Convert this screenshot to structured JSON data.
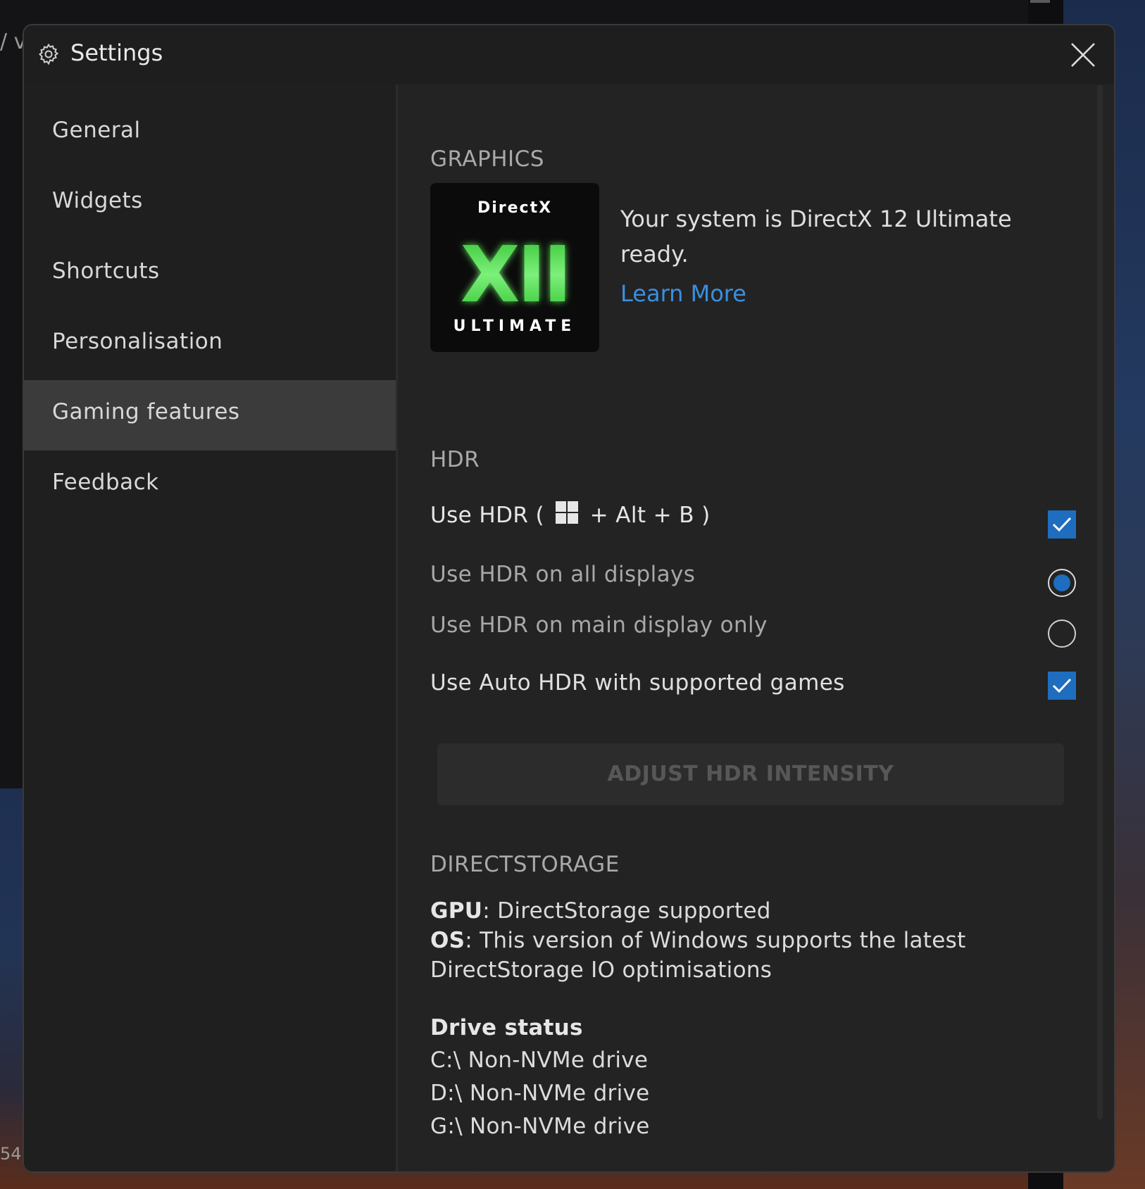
{
  "window": {
    "title": "Settings"
  },
  "sidebar": {
    "items": [
      {
        "label": "General"
      },
      {
        "label": "Widgets"
      },
      {
        "label": "Shortcuts"
      },
      {
        "label": "Personalisation"
      },
      {
        "label": "Gaming features",
        "active": true
      },
      {
        "label": "Feedback"
      }
    ]
  },
  "graphics": {
    "heading": "GRAPHICS",
    "logo": {
      "top": "DirectX",
      "numeral": "XII",
      "bottom": "ULTIMATE"
    },
    "description": "Your system is DirectX 12 Ultimate ready.",
    "learn_more": "Learn More"
  },
  "hdr": {
    "heading": "HDR",
    "use_hdr": {
      "prefix": "Use HDR (",
      "suffix": "+ Alt + B )",
      "checked": true
    },
    "all_displays": {
      "label": "Use HDR on all displays",
      "selected": true
    },
    "main_display": {
      "label": "Use HDR on main display only",
      "selected": false
    },
    "auto_hdr": {
      "label": "Use Auto HDR with supported games",
      "checked": true
    },
    "adjust_button": "ADJUST HDR INTENSITY"
  },
  "directstorage": {
    "heading": "DIRECTSTORAGE",
    "gpu_label": "GPU",
    "gpu_value": ": DirectStorage supported",
    "os_label": "OS",
    "os_value_line1": ": This version of Windows supports the latest",
    "os_value_line2": "DirectStorage IO optimisations",
    "drive_status_heading": "Drive status",
    "drives": [
      "C:\\ Non-NVMe drive",
      "D:\\ Non-NVMe drive",
      "G:\\ Non-NVMe drive"
    ]
  },
  "background": {
    "glyph": "/ v",
    "number": "54"
  },
  "colors": {
    "accent": "#1f6dbf",
    "link": "#3a8fe0",
    "dialog_bg": "#232323",
    "sidebar_active": "#3b3b3b"
  }
}
